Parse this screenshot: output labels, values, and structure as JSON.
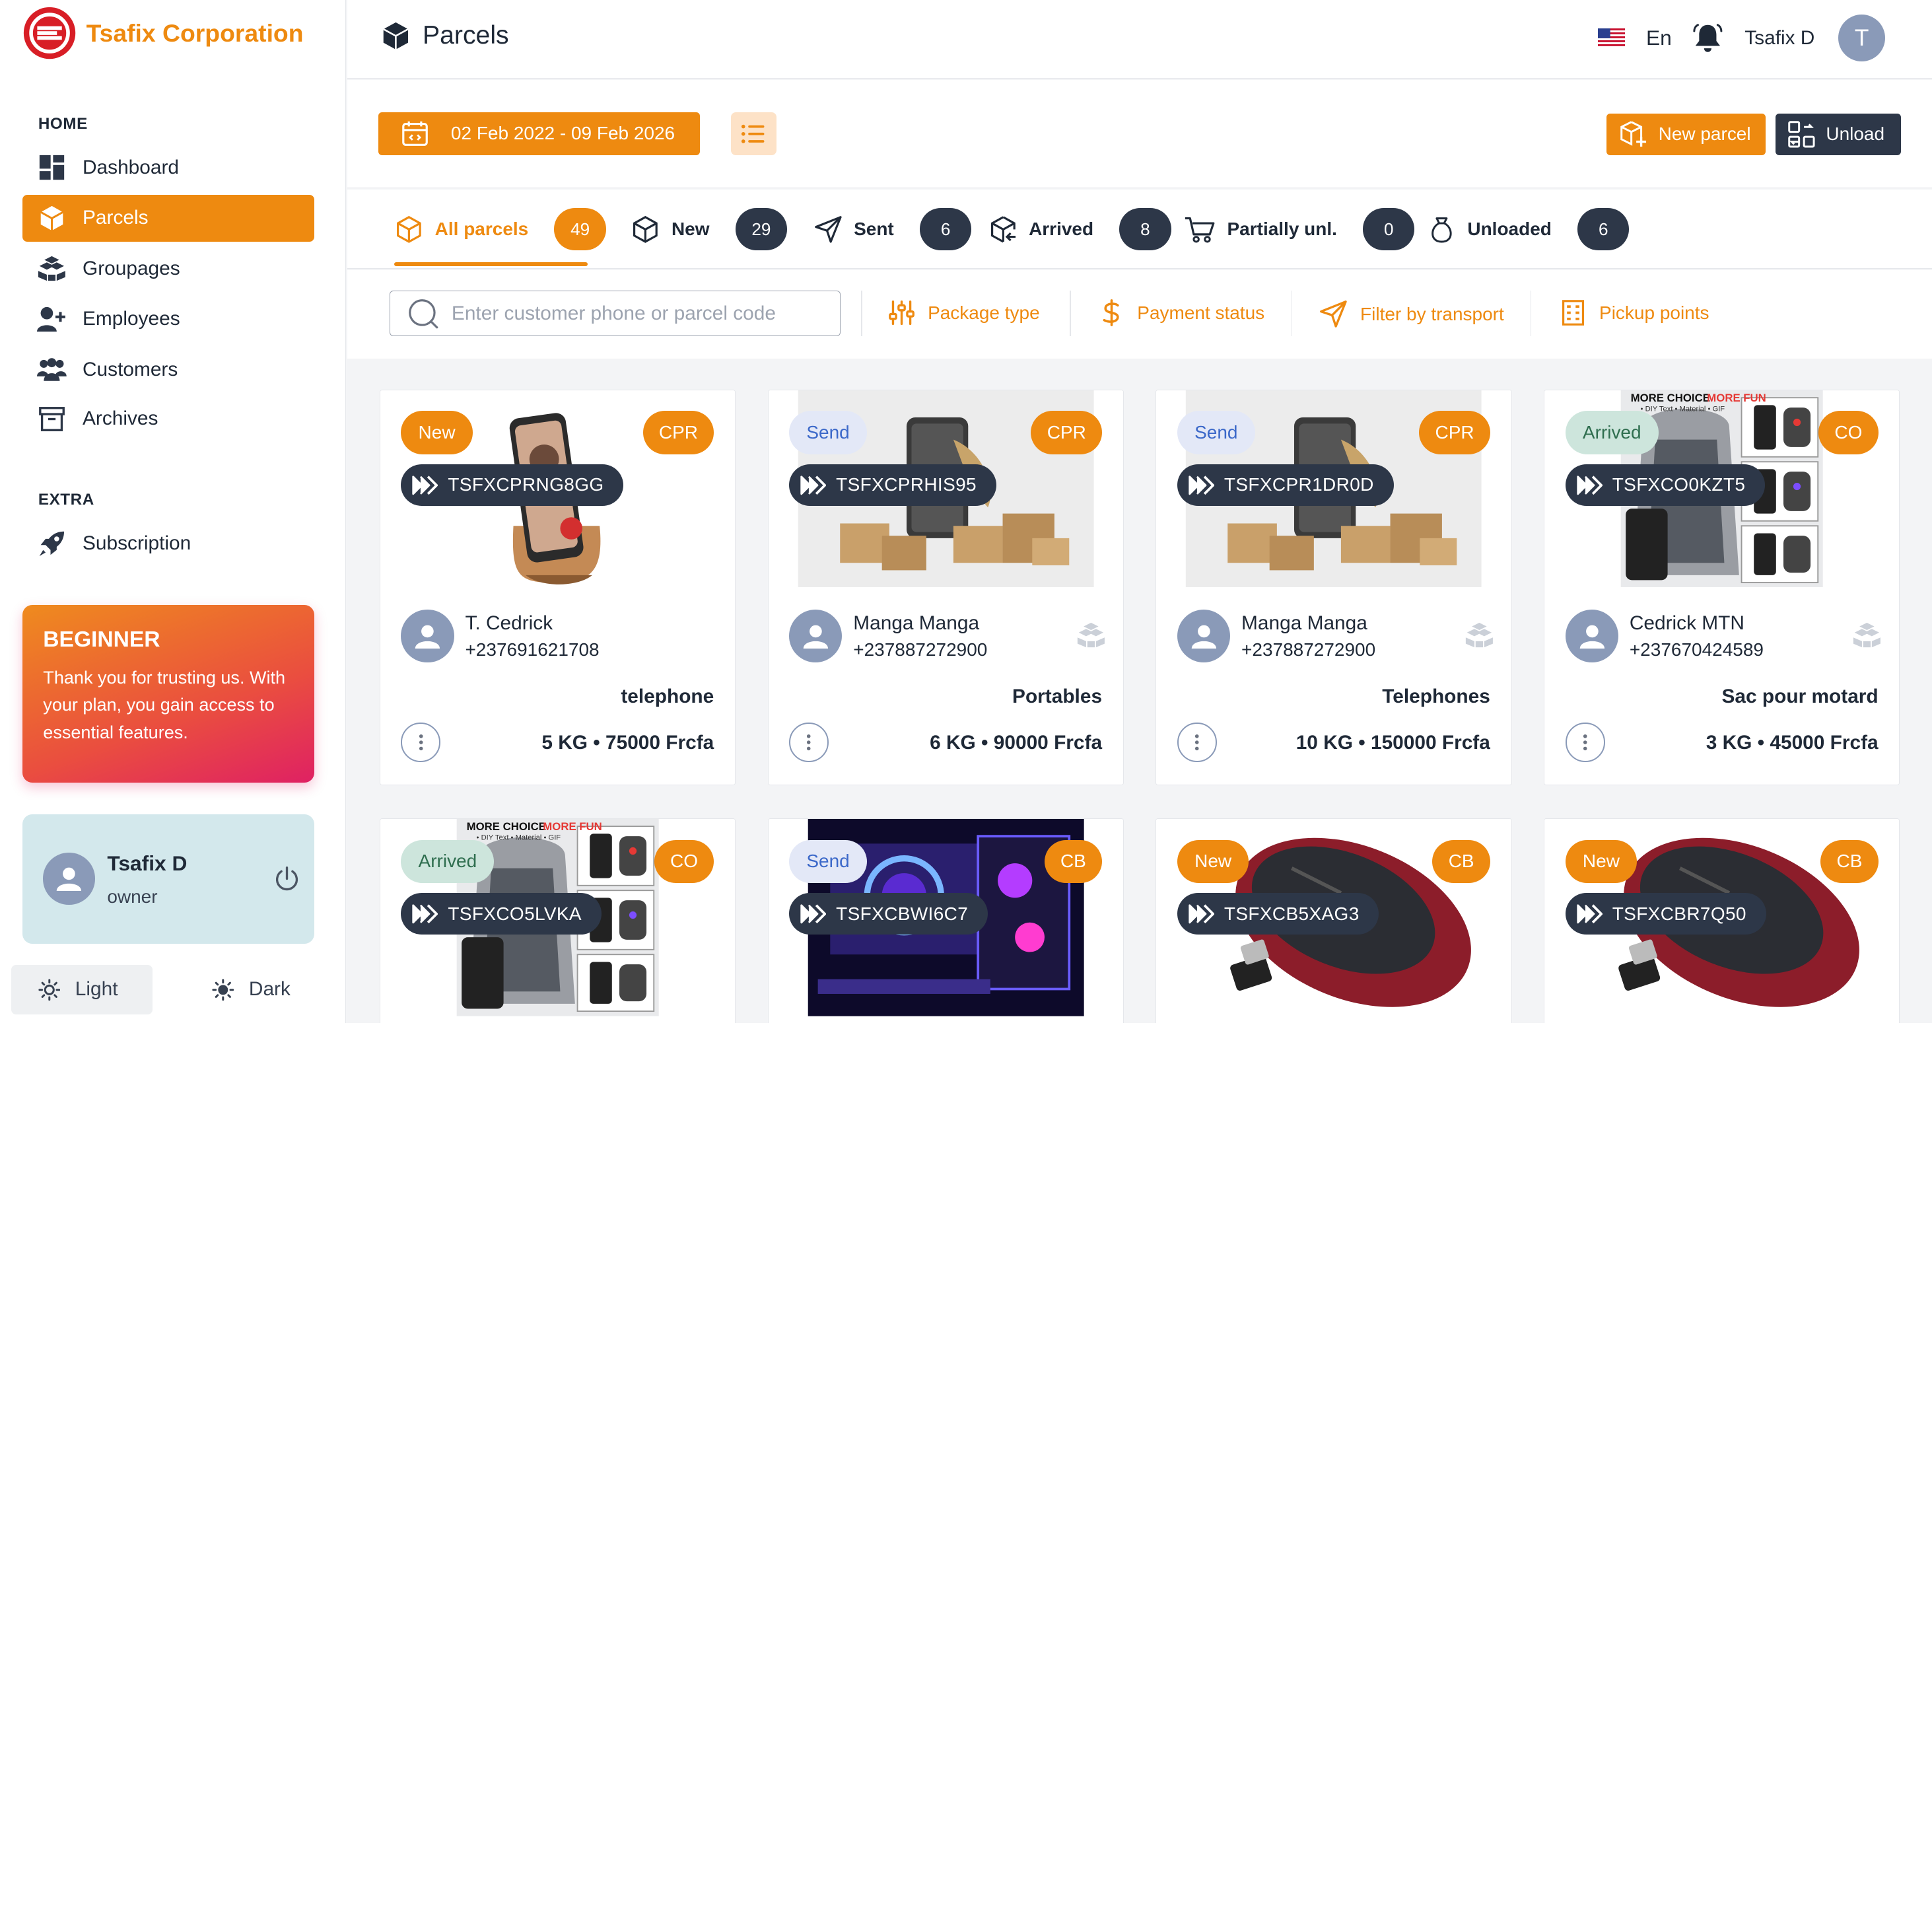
{
  "brand": {
    "name": "Tsafix Corporation"
  },
  "sidebar": {
    "section_home": "HOME",
    "section_extra": "EXTRA",
    "items": [
      {
        "label": "Dashboard",
        "icon": "grid-icon"
      },
      {
        "label": "Parcels",
        "icon": "box-icon",
        "active": true
      },
      {
        "label": "Groupages",
        "icon": "boxes-icon"
      },
      {
        "label": "Employees",
        "icon": "user-plus-icon"
      },
      {
        "label": "Customers",
        "icon": "users-icon"
      },
      {
        "label": "Archives",
        "icon": "archive-icon"
      }
    ],
    "extra_items": [
      {
        "label": "Subscription",
        "icon": "rocket-icon"
      }
    ],
    "plan": {
      "title": "BEGINNER",
      "text": "Thank you for trusting us. With your plan, you gain access to essential features."
    },
    "user": {
      "name": "Tsafix D",
      "role": "owner"
    },
    "theme": {
      "light": "Light",
      "dark": "Dark"
    }
  },
  "header": {
    "title": "Parcels",
    "lang": "En",
    "user_name": "Tsafix D",
    "avatar_letter": "T"
  },
  "toolbar": {
    "date_range": "02 Feb 2022 - 09 Feb 2026",
    "new_parcel": "New parcel",
    "unload": "Unload"
  },
  "tabs": [
    {
      "label": "All parcels",
      "count": "49",
      "active": true
    },
    {
      "label": "New",
      "count": "29"
    },
    {
      "label": "Sent",
      "count": "6"
    },
    {
      "label": "Arrived",
      "count": "8"
    },
    {
      "label": "Partially unl.",
      "count": "0"
    },
    {
      "label": "Unloaded",
      "count": "6"
    }
  ],
  "filters": {
    "search_placeholder": "Enter customer phone or parcel code",
    "package_type": "Package type",
    "payment_status": "Payment status",
    "transport": "Filter by transport",
    "pickup": "Pickup points"
  },
  "parcels": [
    {
      "status": "New",
      "type": "CPR",
      "code": "TSFXCPRNG8GG",
      "customer": "T. Cedrick",
      "phone": "+237691621708",
      "desc": "telephone",
      "price": "5 KG  •  75000 Frcfa"
    },
    {
      "status": "Send",
      "type": "CPR",
      "code": "TSFXCPRHIS95",
      "customer": "Manga Manga",
      "phone": "+237887272900",
      "desc": "Portables",
      "price": "6 KG  •  90000 Frcfa"
    },
    {
      "status": "Send",
      "type": "CPR",
      "code": "TSFXCPR1DR0D",
      "customer": "Manga Manga",
      "phone": "+237887272900",
      "desc": "Telephones",
      "price": "10 KG  •  150000 Frcfa"
    },
    {
      "status": "Arrived",
      "type": "CO",
      "code": "TSFXCO0KZT5",
      "customer": "Cedrick MTN",
      "phone": "+237670424589",
      "desc": "Sac pour motard",
      "price": "3 KG  •  45000 Frcfa"
    },
    {
      "status": "Arrived",
      "type": "CO",
      "code": "TSFXCO5LVKA"
    },
    {
      "status": "Send",
      "type": "CB",
      "code": "TSFXCBWI6C7"
    },
    {
      "status": "New",
      "type": "CB",
      "code": "TSFXCB5XAG3"
    },
    {
      "status": "New",
      "type": "CB",
      "code": "TSFXCBR7Q50"
    }
  ]
}
